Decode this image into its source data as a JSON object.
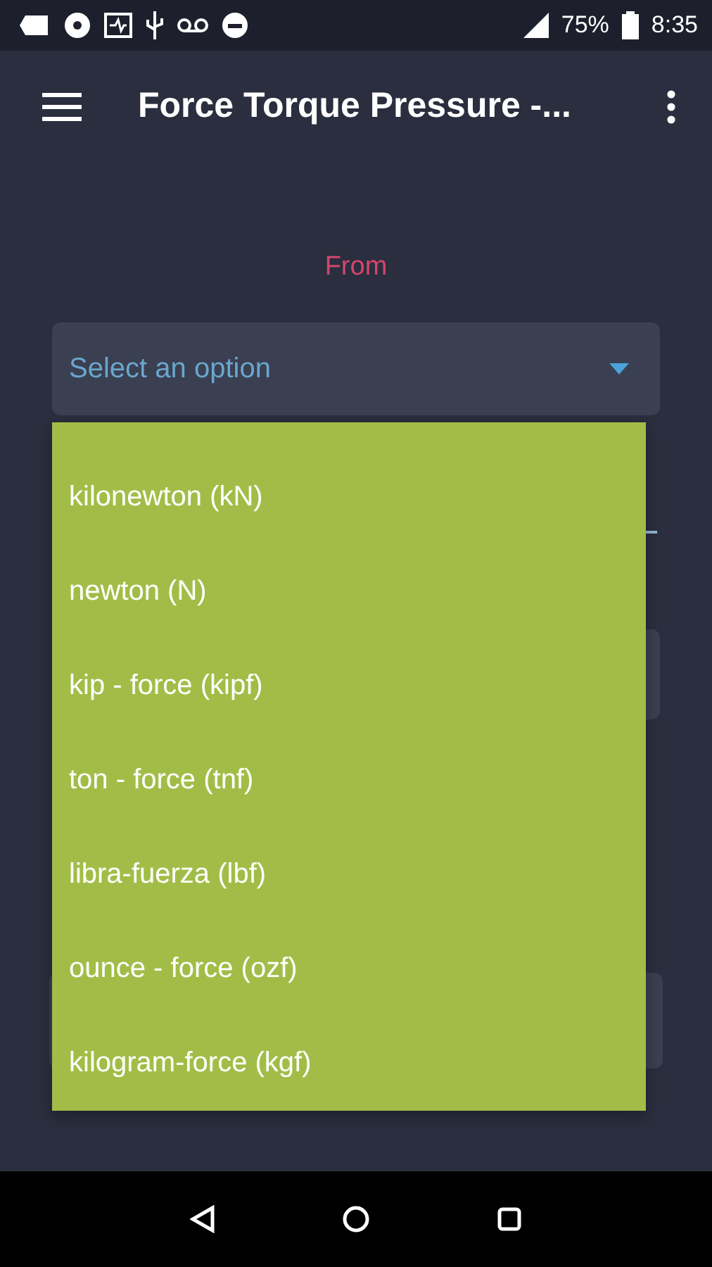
{
  "status_bar": {
    "battery": "75%",
    "time": "8:35"
  },
  "app_bar": {
    "title": "Force Torque Pressure -..."
  },
  "from_label": "From",
  "from_select": {
    "placeholder": "Select an option",
    "expanded": true
  },
  "dropdown": {
    "options": [
      {
        "label": "kilonewton (kN)",
        "selected": false
      },
      {
        "label": "newton (N)",
        "selected": false
      },
      {
        "label": "kip - force (kipf)",
        "selected": false
      },
      {
        "label": "ton - force (tnf)",
        "selected": false
      },
      {
        "label": "libra-fuerza (lbf)",
        "selected": false
      },
      {
        "label": "ounce - force (ozf)",
        "selected": false
      },
      {
        "label": "kilogram-force (kgf)",
        "selected": false
      }
    ]
  }
}
